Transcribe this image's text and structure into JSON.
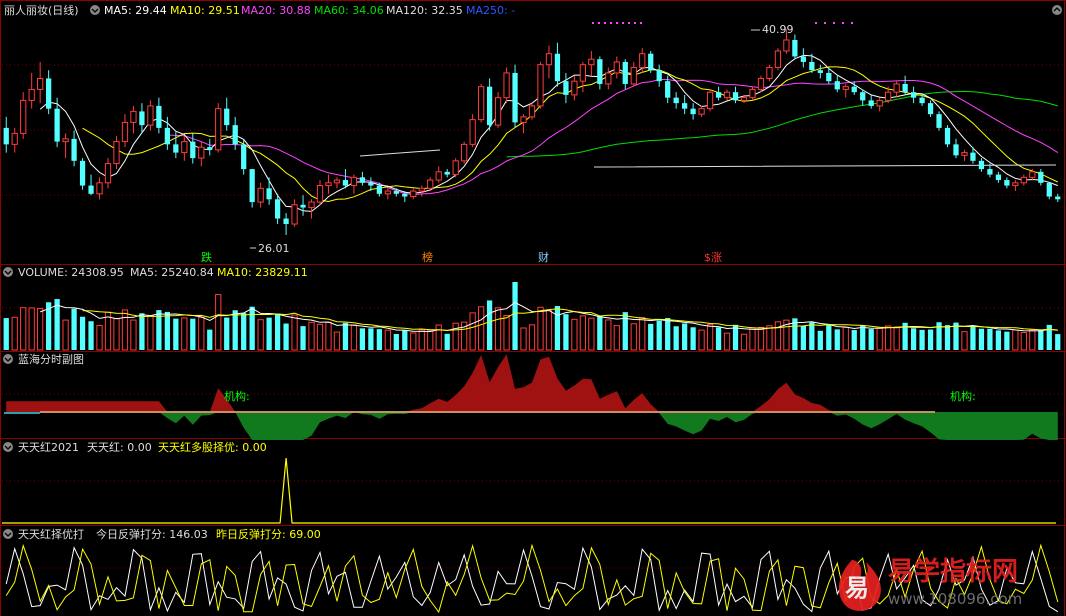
{
  "colors": {
    "bg": "#000000",
    "border": "#8b0000",
    "grid": "#7a0000",
    "up": "#ff3c3c",
    "down": "#54ffff",
    "ma5": "#ffffff",
    "ma10": "#ffff00",
    "ma20": "#ff44ff",
    "ma60": "#00dd00",
    "ma120": "#dddddd",
    "ma250": "#3355ff",
    "label": "#dddddd",
    "redArea": "#a01212",
    "greenArea": "#127a1e",
    "flat": "#c89060",
    "yellow": "#ffff00"
  },
  "main_panel": {
    "stock_name": "丽人丽妆(日线)",
    "ma_labels": [
      {
        "text": "MA5: 29.44",
        "color": "#ffffff"
      },
      {
        "text": "MA10: 29.51",
        "color": "#ffff00"
      },
      {
        "text": "MA20: 30.88",
        "color": "#ff44ff"
      },
      {
        "text": "MA60: 34.06",
        "color": "#00dd00"
      },
      {
        "text": "MA120: 32.35",
        "color": "#dddddd"
      },
      {
        "text": "MA250: -",
        "color": "#3355ff"
      }
    ],
    "high_label": "40.99",
    "low_label": "26.01",
    "event_markers": [
      {
        "text": "跌",
        "color": "#00ff00"
      },
      {
        "text": "榜",
        "color": "#ff8800"
      },
      {
        "text": "财",
        "color": "#88ccff"
      },
      {
        "text": "$涨",
        "color": "#ff3333"
      }
    ]
  },
  "volume_panel": {
    "labels": [
      {
        "text": "VOLUME: 24308.95",
        "color": "#dddddd"
      },
      {
        "text": "MA5: 25240.84",
        "color": "#dddddd"
      },
      {
        "text": "MA10: 23829.11",
        "color": "#ffff00"
      }
    ]
  },
  "lanhai_panel": {
    "title": "蓝海分时副图",
    "annotations": [
      "机构:",
      "机构:"
    ]
  },
  "tth_panel": {
    "labels": [
      {
        "text": "天天红2021",
        "color": "#dddddd"
      },
      {
        "text": "天天红: 0.00",
        "color": "#dddddd"
      },
      {
        "text": "天天红多股择优: 0.00",
        "color": "#ffff00"
      }
    ]
  },
  "score_panel": {
    "labels": [
      {
        "text": "天天红择优打",
        "color": "#dddddd"
      },
      {
        "text": "今日反弹打分: 146.03",
        "color": "#dddddd"
      },
      {
        "text": "昨日反弹打分: 69.00",
        "color": "#ffff00"
      }
    ]
  },
  "watermark": {
    "logo_char": "易",
    "name": "易学指标网",
    "url": "www.108096.com"
  },
  "chart_data": {
    "type": "candlestick",
    "title": "丽人丽妆(日线)",
    "price_high": 40.99,
    "price_low": 26.01,
    "candles": [
      [
        33.8,
        34.6,
        32.0,
        32.6
      ],
      [
        32.6,
        33.8,
        32.0,
        33.4
      ],
      [
        33.4,
        36.4,
        33.0,
        35.8
      ],
      [
        35.8,
        37.8,
        35.2,
        36.6
      ],
      [
        36.6,
        38.6,
        35.6,
        37.4
      ],
      [
        37.4,
        38.0,
        34.8,
        35.2
      ],
      [
        35.2,
        36.0,
        32.4,
        32.8
      ],
      [
        32.8,
        33.4,
        31.6,
        33.0
      ],
      [
        33.0,
        33.6,
        31.0,
        31.4
      ],
      [
        31.4,
        31.6,
        29.3,
        29.6
      ],
      [
        29.6,
        30.4,
        28.9,
        29.0
      ],
      [
        29.0,
        30.2,
        28.6,
        29.8
      ],
      [
        29.8,
        31.6,
        29.4,
        31.2
      ],
      [
        31.2,
        33.2,
        30.8,
        32.8
      ],
      [
        32.8,
        34.8,
        32.4,
        34.2
      ],
      [
        34.2,
        35.4,
        33.4,
        35.0
      ],
      [
        35.0,
        35.6,
        33.4,
        34.0
      ],
      [
        34.0,
        35.8,
        33.6,
        35.4
      ],
      [
        35.4,
        36.0,
        33.4,
        33.8
      ],
      [
        33.8,
        34.6,
        32.2,
        32.6
      ],
      [
        32.6,
        33.6,
        31.6,
        32.0
      ],
      [
        32.0,
        33.2,
        31.4,
        32.8
      ],
      [
        32.8,
        33.4,
        31.2,
        31.6
      ],
      [
        31.6,
        32.8,
        31.0,
        32.4
      ],
      [
        32.4,
        33.0,
        31.8,
        32.2
      ],
      [
        32.2,
        35.6,
        32.0,
        35.2
      ],
      [
        35.2,
        36.0,
        33.6,
        34.0
      ],
      [
        34.0,
        34.6,
        32.2,
        32.6
      ],
      [
        32.6,
        33.0,
        30.4,
        30.8
      ],
      [
        30.8,
        30.8,
        28.0,
        28.4
      ],
      [
        28.4,
        29.8,
        28.0,
        29.4
      ],
      [
        29.4,
        30.2,
        28.2,
        28.6
      ],
      [
        28.6,
        29.0,
        26.8,
        27.2
      ],
      [
        27.2,
        27.6,
        26.0,
        26.8
      ],
      [
        26.8,
        28.6,
        26.6,
        28.2
      ],
      [
        28.2,
        28.9,
        27.4,
        28.0
      ],
      [
        28.0,
        28.6,
        27.2,
        28.4
      ],
      [
        28.4,
        30.0,
        28.2,
        29.6
      ],
      [
        29.6,
        30.4,
        29.0,
        29.8
      ],
      [
        29.8,
        30.2,
        29.4,
        30.0
      ],
      [
        30.0,
        30.8,
        29.4,
        29.6
      ],
      [
        29.6,
        30.4,
        29.0,
        30.2
      ],
      [
        30.2,
        30.6,
        29.6,
        29.8
      ],
      [
        29.8,
        30.2,
        29.2,
        29.6
      ],
      [
        29.6,
        29.8,
        28.8,
        29.0
      ],
      [
        29.0,
        29.4,
        28.6,
        29.2
      ],
      [
        29.2,
        29.4,
        28.8,
        29.0
      ],
      [
        29.0,
        29.2,
        28.4,
        28.8
      ],
      [
        28.8,
        29.4,
        28.6,
        29.2
      ],
      [
        29.2,
        29.6,
        28.8,
        29.4
      ],
      [
        29.4,
        30.2,
        29.2,
        30.0
      ],
      [
        30.0,
        31.0,
        29.8,
        30.6
      ],
      [
        30.6,
        30.8,
        30.2,
        30.4
      ],
      [
        30.4,
        31.6,
        30.2,
        31.4
      ],
      [
        31.4,
        32.8,
        31.2,
        32.6
      ],
      [
        32.6,
        34.8,
        32.4,
        34.4
      ],
      [
        34.4,
        37.0,
        34.2,
        36.8
      ],
      [
        36.8,
        37.4,
        33.6,
        34.0
      ],
      [
        34.0,
        36.4,
        33.8,
        36.0
      ],
      [
        36.0,
        38.2,
        35.6,
        37.8
      ],
      [
        37.8,
        38.4,
        33.8,
        34.2
      ],
      [
        34.2,
        34.8,
        33.4,
        34.6
      ],
      [
        34.6,
        35.6,
        34.4,
        35.4
      ],
      [
        35.4,
        38.6,
        35.2,
        38.4
      ],
      [
        38.4,
        39.8,
        37.4,
        39.2
      ],
      [
        39.2,
        40.0,
        36.8,
        37.2
      ],
      [
        37.2,
        37.8,
        35.6,
        36.2
      ],
      [
        36.2,
        37.6,
        35.8,
        37.2
      ],
      [
        37.2,
        38.6,
        36.4,
        38.4
      ],
      [
        38.4,
        39.4,
        37.6,
        38.8
      ],
      [
        38.8,
        39.0,
        36.6,
        37.0
      ],
      [
        37.0,
        38.2,
        36.6,
        37.8
      ],
      [
        37.8,
        39.0,
        37.4,
        38.6
      ],
      [
        38.6,
        38.8,
        36.6,
        37.0
      ],
      [
        37.0,
        38.6,
        36.8,
        38.2
      ],
      [
        38.2,
        39.6,
        37.8,
        39.2
      ],
      [
        39.2,
        39.4,
        37.8,
        38.0
      ],
      [
        38.0,
        38.4,
        36.8,
        37.2
      ],
      [
        37.2,
        37.6,
        35.6,
        36.0
      ],
      [
        36.0,
        36.4,
        35.2,
        35.6
      ],
      [
        35.6,
        36.2,
        34.8,
        35.2
      ],
      [
        35.2,
        35.6,
        34.4,
        34.8
      ],
      [
        34.8,
        35.4,
        34.6,
        35.2
      ],
      [
        35.2,
        36.6,
        35.0,
        36.4
      ],
      [
        36.4,
        36.8,
        35.8,
        36.0
      ],
      [
        36.0,
        36.6,
        35.8,
        36.4
      ],
      [
        36.4,
        36.8,
        35.6,
        35.8
      ],
      [
        35.8,
        36.2,
        35.6,
        36.0
      ],
      [
        36.0,
        36.8,
        35.8,
        36.6
      ],
      [
        36.6,
        37.6,
        36.4,
        37.4
      ],
      [
        37.4,
        38.4,
        37.2,
        38.2
      ],
      [
        38.2,
        39.6,
        38.0,
        39.4
      ],
      [
        39.4,
        40.99,
        39.2,
        40.2
      ],
      [
        40.2,
        40.6,
        38.8,
        39.0
      ],
      [
        39.0,
        39.6,
        38.2,
        38.6
      ],
      [
        38.6,
        39.2,
        37.8,
        38.0
      ],
      [
        38.0,
        38.4,
        37.4,
        37.8
      ],
      [
        37.8,
        38.2,
        37.0,
        37.2
      ],
      [
        37.2,
        37.6,
        36.4,
        36.6
      ],
      [
        36.6,
        37.0,
        36.0,
        36.8
      ],
      [
        36.8,
        37.2,
        36.2,
        36.4
      ],
      [
        36.4,
        36.6,
        35.4,
        35.8
      ],
      [
        35.8,
        36.2,
        35.2,
        35.4
      ],
      [
        35.4,
        36.0,
        35.0,
        35.8
      ],
      [
        35.8,
        36.8,
        35.6,
        36.4
      ],
      [
        36.4,
        37.2,
        36.0,
        37.0
      ],
      [
        37.0,
        37.6,
        36.2,
        36.4
      ],
      [
        36.4,
        36.8,
        35.6,
        36.0
      ],
      [
        36.0,
        36.2,
        35.4,
        35.6
      ],
      [
        35.6,
        35.8,
        34.6,
        34.8
      ],
      [
        34.8,
        35.0,
        33.6,
        33.8
      ],
      [
        33.8,
        34.0,
        32.4,
        32.6
      ],
      [
        32.6,
        33.0,
        31.6,
        31.8
      ],
      [
        31.8,
        32.2,
        31.4,
        32.0
      ],
      [
        32.0,
        32.4,
        31.2,
        31.4
      ],
      [
        31.4,
        31.6,
        30.6,
        30.8
      ],
      [
        30.8,
        31.2,
        30.2,
        30.4
      ],
      [
        30.4,
        30.6,
        29.8,
        30.0
      ],
      [
        30.0,
        30.2,
        29.4,
        29.6
      ],
      [
        29.6,
        30.0,
        29.2,
        29.8
      ],
      [
        29.8,
        30.4,
        29.6,
        30.2
      ],
      [
        30.2,
        30.8,
        30.0,
        30.6
      ],
      [
        30.6,
        30.8,
        29.6,
        29.8
      ],
      [
        29.8,
        29.8,
        28.6,
        28.8
      ],
      [
        28.8,
        29.0,
        28.4,
        28.6
      ]
    ],
    "ma5_last": 29.44,
    "ma10_last": 29.51,
    "ma20_last": 30.88,
    "ma60_last": 34.06,
    "ma120_last": 32.35,
    "volume_last": 24308.95,
    "volume_ma5": 25240.84,
    "volume_ma10": 23829.11,
    "tianhong_last": 0.0,
    "tianhong_best_last": 0.0,
    "today_score": 146.03,
    "yesterday_score": 69.0
  }
}
